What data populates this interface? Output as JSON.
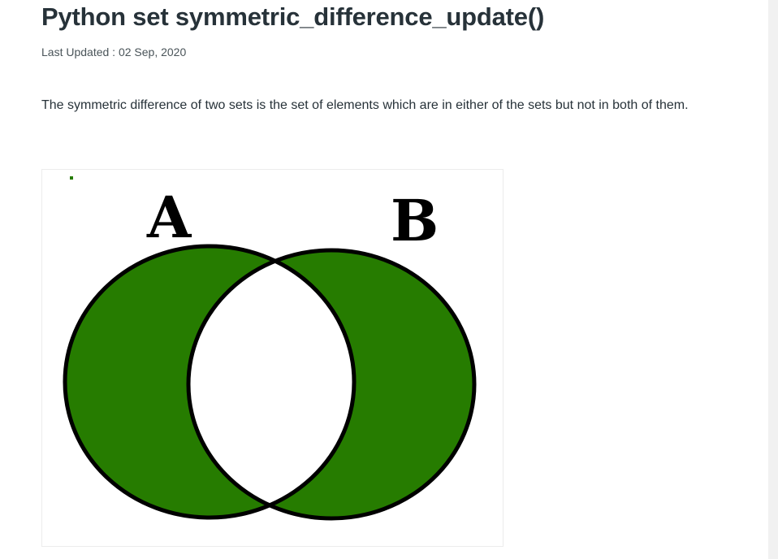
{
  "article": {
    "title": "Python set symmetric_difference_update()",
    "last_updated": "Last Updated : 02 Sep, 2020",
    "paragraph": "The symmetric difference of two sets is the set of elements which are in either of the sets but not in both of them."
  },
  "figure": {
    "label_a": "A",
    "label_b": "B",
    "fill_color": "#267c00",
    "stroke_color": "#000000",
    "background": "#ffffff"
  }
}
